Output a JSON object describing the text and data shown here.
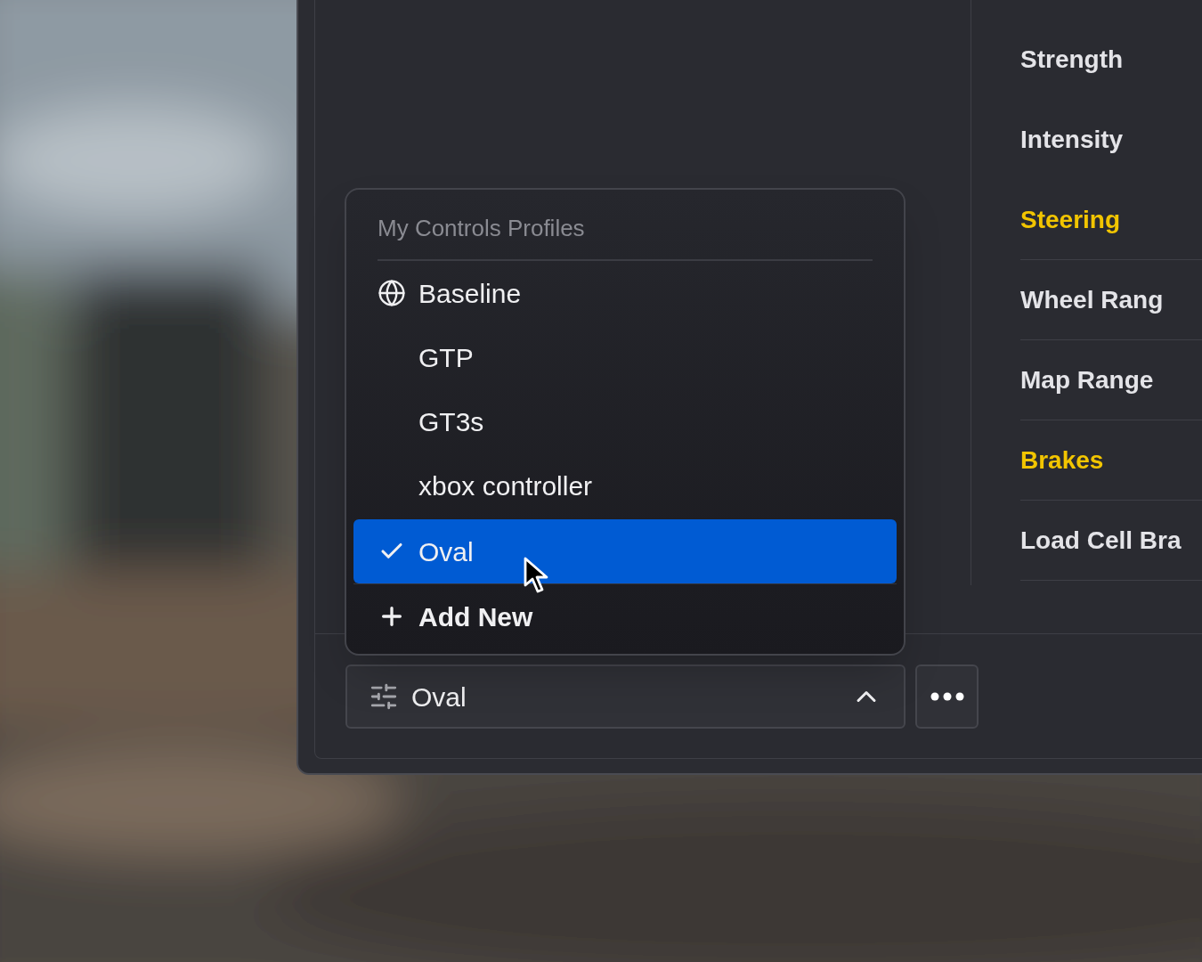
{
  "side_menu": {
    "items": [
      {
        "label": "Strength",
        "kind": "item"
      },
      {
        "label": "Intensity",
        "kind": "item"
      },
      {
        "label": "Steering",
        "kind": "heading"
      },
      {
        "label": "Wheel Rang",
        "kind": "item"
      },
      {
        "label": "Map Range",
        "kind": "item"
      },
      {
        "label": "Brakes",
        "kind": "heading"
      },
      {
        "label": "Load Cell Bra",
        "kind": "item"
      }
    ]
  },
  "profile_menu": {
    "title": "My Controls Profiles",
    "items": [
      {
        "label": "Baseline",
        "kind": "global",
        "selected": false
      },
      {
        "label": "GTP",
        "kind": "custom",
        "selected": false
      },
      {
        "label": "GT3s",
        "kind": "custom",
        "selected": false
      },
      {
        "label": "xbox controller",
        "kind": "custom",
        "selected": false
      },
      {
        "label": "Oval",
        "kind": "custom",
        "selected": true
      }
    ],
    "add_label": "Add New"
  },
  "profile_select": {
    "value": "Oval",
    "expanded": true
  }
}
